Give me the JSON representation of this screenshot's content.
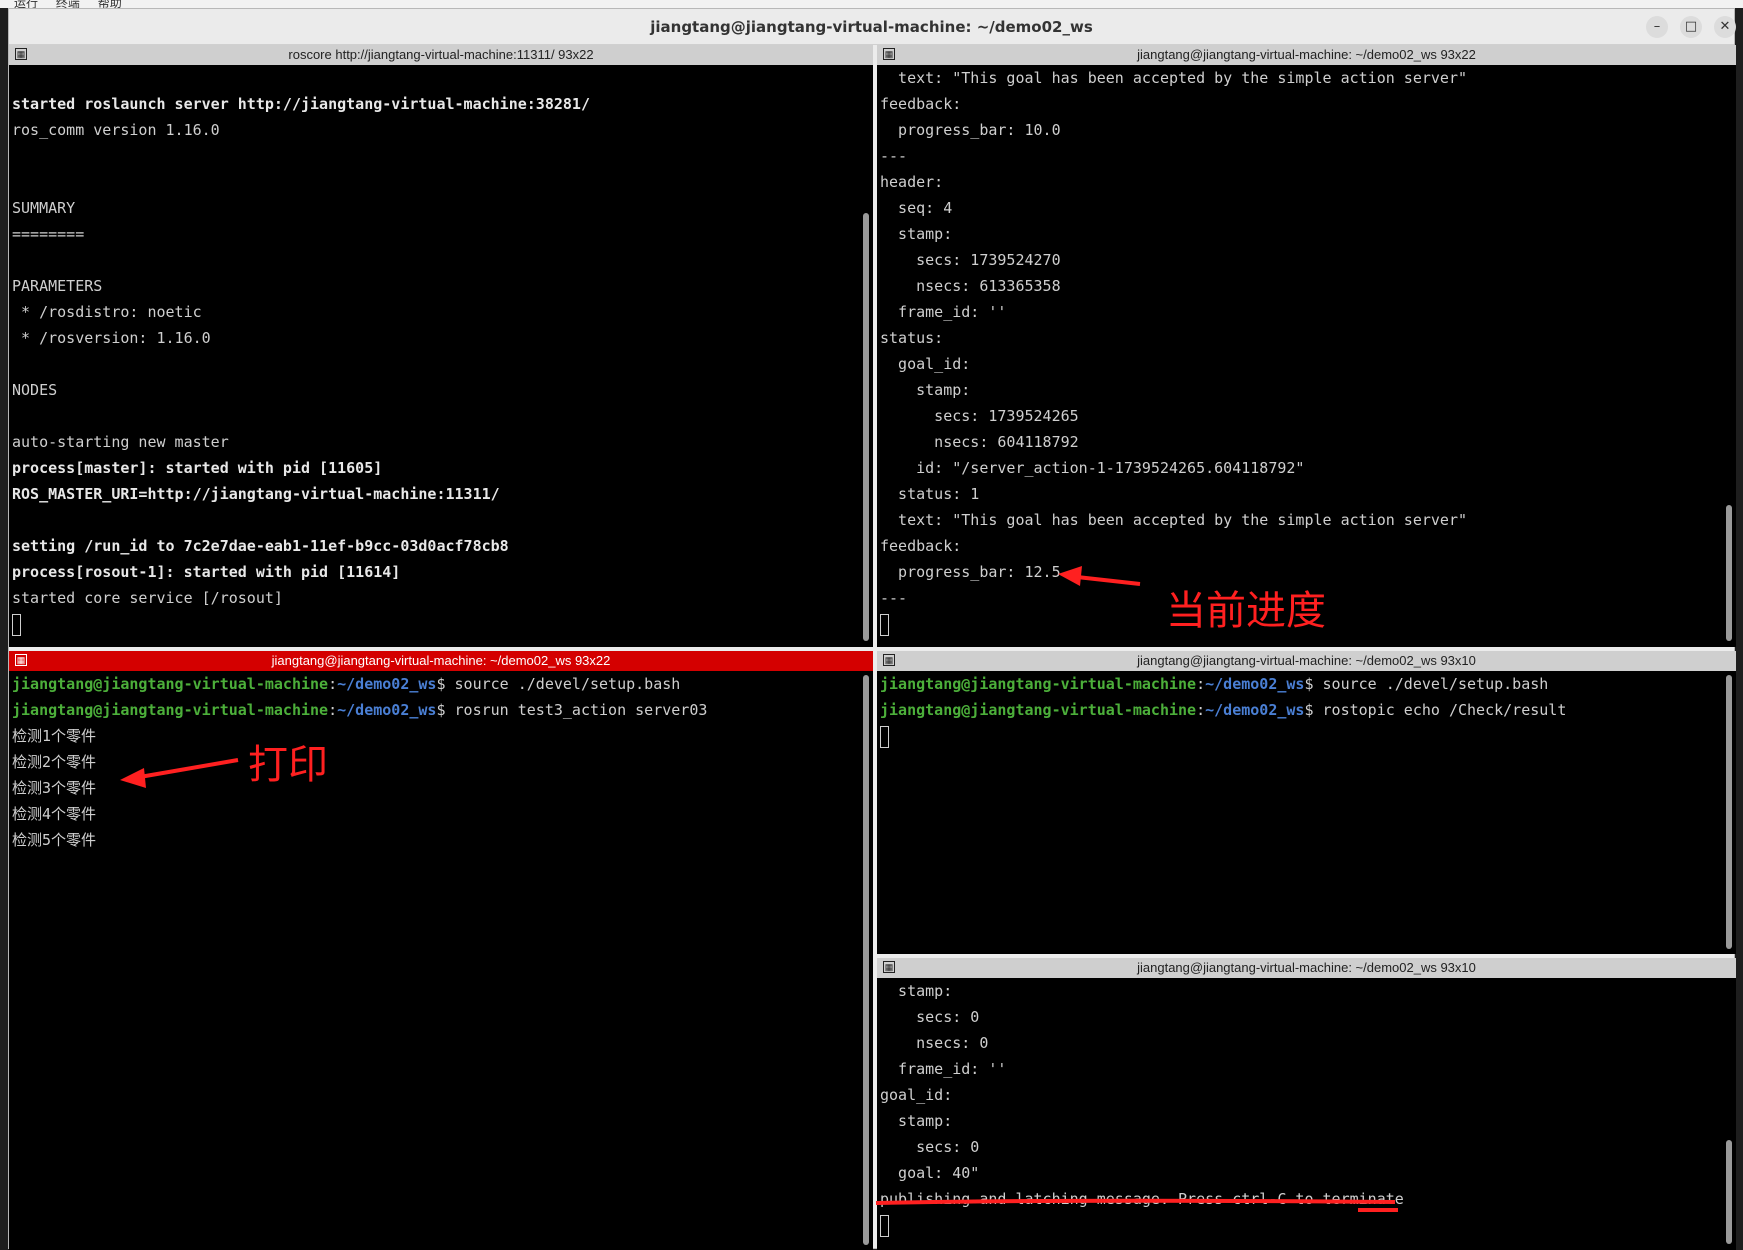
{
  "menubar": {
    "items": [
      "运行",
      "终端",
      "帮助"
    ]
  },
  "window": {
    "title": "jiangtang@jiangtang-virtual-machine: ~/demo02_ws"
  },
  "panes": {
    "top_left": {
      "header": "roscore http://jiangtang-virtual-machine:11311/ 93x22",
      "lines": [
        {
          "t": "",
          "bold": false
        },
        {
          "t": "started roslaunch server http://jiangtang-virtual-machine:38281/",
          "bold": true
        },
        {
          "t": "ros_comm version 1.16.0",
          "bold": false
        },
        {
          "t": "",
          "bold": false
        },
        {
          "t": "",
          "bold": false
        },
        {
          "t": "SUMMARY",
          "bold": false
        },
        {
          "t": "========",
          "bold": false
        },
        {
          "t": "",
          "bold": false
        },
        {
          "t": "PARAMETERS",
          "bold": false
        },
        {
          "t": " * /rosdistro: noetic",
          "bold": false
        },
        {
          "t": " * /rosversion: 1.16.0",
          "bold": false
        },
        {
          "t": "",
          "bold": false
        },
        {
          "t": "NODES",
          "bold": false
        },
        {
          "t": "",
          "bold": false
        },
        {
          "t": "auto-starting new master",
          "bold": false
        },
        {
          "t": "process[master]: started with pid [11605]",
          "bold": true
        },
        {
          "t": "ROS_MASTER_URI=http://jiangtang-virtual-machine:11311/",
          "bold": true
        },
        {
          "t": "",
          "bold": false
        },
        {
          "t": "setting /run_id to 7c2e7dae-eab1-11ef-b9cc-03d0acf78cb8",
          "bold": true
        },
        {
          "t": "process[rosout-1]: started with pid [11614]",
          "bold": true
        },
        {
          "t": "started core service [/rosout]",
          "bold": false
        }
      ]
    },
    "top_right": {
      "header": "jiangtang@jiangtang-virtual-machine: ~/demo02_ws 93x22",
      "lines": [
        "  text: \"This goal has been accepted by the simple action server\"",
        "feedback:",
        "  progress_bar: 10.0",
        "---",
        "header:",
        "  seq: 4",
        "  stamp:",
        "    secs: 1739524270",
        "    nsecs: 613365358",
        "  frame_id: ''",
        "status:",
        "  goal_id:",
        "    stamp:",
        "      secs: 1739524265",
        "      nsecs: 604118792",
        "    id: \"/server_action-1-1739524265.604118792\"",
        "  status: 1",
        "  text: \"This goal has been accepted by the simple action server\"",
        "feedback:",
        "  progress_bar: 12.5",
        "---"
      ]
    },
    "bottom_left": {
      "header": "jiangtang@jiangtang-virtual-machine: ~/demo02_ws 93x22",
      "prompt_user": "jiangtang@jiangtang-virtual-machine",
      "prompt_path": "~/demo02_ws",
      "cmd1": " source ./devel/setup.bash",
      "cmd2": " rosrun test3_action server03",
      "output": [
        "检测1个零件",
        "检测2个零件",
        "检测3个零件",
        "检测4个零件",
        "检测5个零件"
      ]
    },
    "mid_right": {
      "header": "jiangtang@jiangtang-virtual-machine: ~/demo02_ws 93x10",
      "prompt_user": "jiangtang@jiangtang-virtual-machine",
      "prompt_path": "~/demo02_ws",
      "cmd1": " source ./devel/setup.bash",
      "cmd2": " rostopic echo /Check/result"
    },
    "bottom_right": {
      "header": "jiangtang@jiangtang-virtual-machine: ~/demo02_ws 93x10",
      "lines": [
        "  stamp:",
        "    secs: 0",
        "    nsecs: 0",
        "  frame_id: ''",
        "goal_id:",
        "  stamp:",
        "    secs: 0",
        "  goal: 40\"",
        "publishing and latching message. Press ctrl-C to terminate"
      ]
    }
  },
  "annotations": {
    "progress": "当前进度",
    "print": "打印",
    "color": "#ff2020"
  },
  "colors": {
    "active_header": "#d40000",
    "prompt_user": "#4caf3a",
    "prompt_path": "#4a7fd4"
  }
}
